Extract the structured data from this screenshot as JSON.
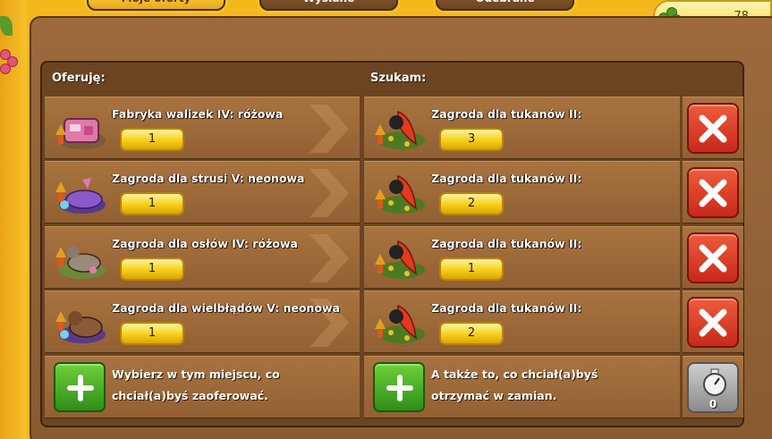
{
  "tabs": [
    {
      "label": "Moje oferty",
      "active": true
    },
    {
      "label": "Wysłane",
      "active": false
    },
    {
      "label": "Odebrane",
      "active": false
    }
  ],
  "currency": {
    "value": "78",
    "icon": "clover-icon",
    "add_icon": "plus-icon"
  },
  "headers": {
    "offer": "Oferuję:",
    "seek": "Szukam:"
  },
  "offers": [
    {
      "name": "Fabryka walizek IV: różowa",
      "qty": "1",
      "icon": "suitcase-factory-icon"
    },
    {
      "name": "Zagroda dla strusi V: neonowa",
      "qty": "1",
      "icon": "ostrich-pen-icon"
    },
    {
      "name": "Zagroda dla osłów IV: różowa",
      "qty": "1",
      "icon": "donkey-pen-icon"
    },
    {
      "name": "Zagroda dla wielbłądów V: neonowa",
      "qty": "1",
      "icon": "camel-pen-icon"
    }
  ],
  "seeks": [
    {
      "name": "Zagroda dla tukanów II:",
      "qty": "3",
      "icon": "toucan-pen-icon"
    },
    {
      "name": "Zagroda dla tukanów II:",
      "qty": "2",
      "icon": "toucan-pen-icon"
    },
    {
      "name": "Zagroda dla tukanów II:",
      "qty": "1",
      "icon": "toucan-pen-icon"
    },
    {
      "name": "Zagroda dla tukanów II:",
      "qty": "2",
      "icon": "toucan-pen-icon"
    }
  ],
  "add_offer": {
    "line1": "Wybierz w tym miejscu, co",
    "line2": "chciał(a)byś zaoferować."
  },
  "add_seek": {
    "line1": "A także to, co chciał(a)byś",
    "line2": "otrzymać w zamian."
  },
  "timer": {
    "count": "0",
    "icon": "stopwatch-icon"
  },
  "colors": {
    "delete": "#d63a24",
    "add": "#3fa61f",
    "quantity": "#f6cf17",
    "wood": "#9c6a3c"
  }
}
